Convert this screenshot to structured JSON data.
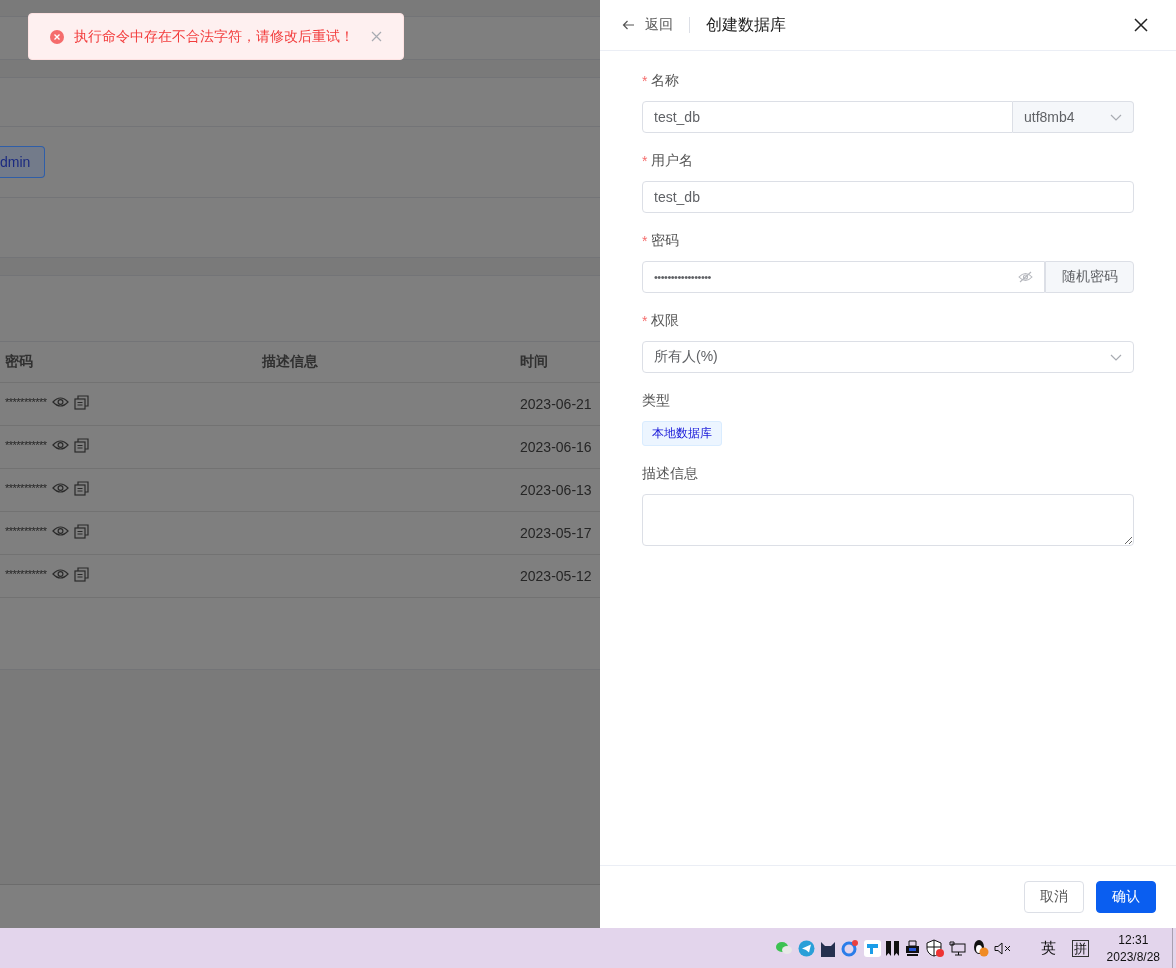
{
  "background_page": {
    "admin_button": "dmin",
    "table": {
      "columns": [
        "密码",
        "描述信息",
        "时间"
      ],
      "rows": [
        {
          "password": "***********",
          "time": "2023-06-21"
        },
        {
          "password": "***********",
          "time": "2023-06-16"
        },
        {
          "password": "***********",
          "time": "2023-06-13"
        },
        {
          "password": "***********",
          "time": "2023-05-17"
        },
        {
          "password": "***********",
          "time": "2023-05-12"
        }
      ]
    }
  },
  "toast": {
    "message": "执行命令中存在不合法字符，请修改后重试！"
  },
  "drawer": {
    "back_label": "返回",
    "title": "创建数据库",
    "fields": [
      {
        "kind": "input-select",
        "label": "名称",
        "required_mark": "*",
        "value": "test_db",
        "select_value": "utf8mb4"
      },
      {
        "kind": "input",
        "label": "用户名",
        "required_mark": "*",
        "value": "test_db"
      },
      {
        "kind": "password",
        "label": "密码",
        "required_mark": "*",
        "value": "•••••••••••••••••",
        "button": "随机密码"
      },
      {
        "kind": "select",
        "label": "权限",
        "required_mark": "*",
        "value": "所有人(%)"
      },
      {
        "kind": "tag",
        "label": "类型",
        "value": "本地数据库"
      },
      {
        "kind": "textarea",
        "label": "描述信息"
      }
    ],
    "buttons": [
      {
        "label": "取消",
        "primary": false
      },
      {
        "label": "确认",
        "primary": true
      }
    ]
  },
  "taskbar": {
    "language": "英",
    "input_mode": "拼",
    "time": "12:31",
    "date": "2023/8/28"
  }
}
